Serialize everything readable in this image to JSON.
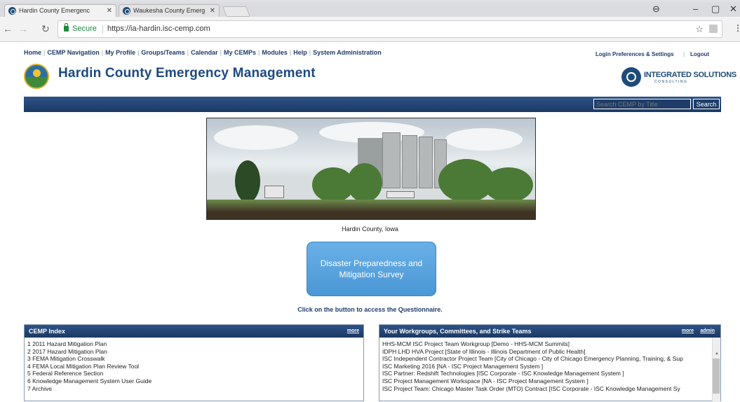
{
  "browser": {
    "tabs": [
      {
        "title": "Hardin County Emergenc"
      },
      {
        "title": "Waukesha County Emerg"
      }
    ],
    "secure_label": "Secure",
    "url": "https://ia-hardin.isc-cemp.com"
  },
  "nav": {
    "items": [
      "Home",
      "CEMP Navigation",
      "My Profile",
      "Groups/Teams",
      "Calendar",
      "My CEMPs",
      "Modules",
      "Help",
      "System Administration"
    ],
    "right_items": [
      "Login Preferences & Settings",
      "Logout"
    ]
  },
  "header": {
    "title": "Hardin County Emergency Management",
    "partner_logo_text": "INTEGRATED SOLUTIONS",
    "partner_logo_sub": "CONSULTING"
  },
  "search": {
    "placeholder": "Search CEMP by Title",
    "button_label": "Search"
  },
  "hero": {
    "caption": "Hardin County, Iowa"
  },
  "survey": {
    "button_label": "Disaster Preparedness and Mitigation Survey",
    "instruction": "Click on the button to access the Questionnaire."
  },
  "cemp_index": {
    "title": "CEMP Index",
    "more_label": "more",
    "items": [
      "1 2011 Hazard Mitigation Plan",
      "2 2017 Hazard Mitigation Plan",
      "3 FEMA Mitigation Crosswalk",
      "4 FEMA Local Mitigation Plan Review Tool",
      "5 Federal Reference Section",
      "6 Knowledge Management System User Guide",
      "7 Archive"
    ]
  },
  "workgroups": {
    "title": "Your Workgroups, Committees, and Strike Teams",
    "more_label": "more",
    "admin_label": "admin",
    "items": [
      "HHS-MCM ISC Project Team Workgroup [Demo - HHS-MCM Summits]",
      "IDPH LHD HVA Project [State of Illinois - Illinois Department of Public Health]",
      "ISC Independent Contractor Project Team [City of Chicago - City of Chicago Emergency Planning, Training, & Sup",
      "ISC Marketing 2016 [NA - ISC Project Management System ]",
      "ISC Partner: Redshift Technologies [ISC Corporate - ISC Knowledge Management System ]",
      "ISC Project Management Workspace [NA - ISC Project Management System ]",
      "ISC Project Team: Chicago Master Task Order (MTO) Contract [ISC Corporate - ISC Knowledge Management Sy"
    ]
  }
}
